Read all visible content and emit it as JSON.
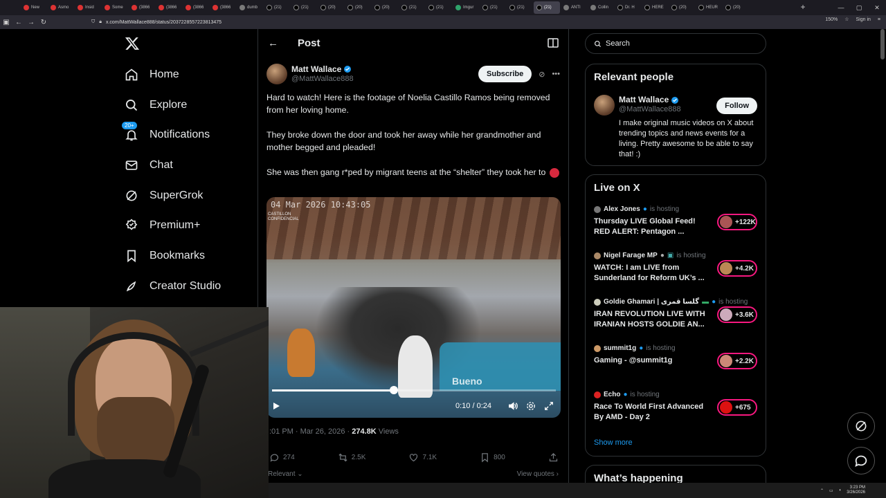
{
  "browser": {
    "tabs": [
      {
        "label": "New",
        "fav": "red"
      },
      {
        "label": "Asmo",
        "fav": "red"
      },
      {
        "label": "Insid",
        "fav": "red"
      },
      {
        "label": "Some",
        "fav": "red"
      },
      {
        "label": "(3866",
        "fav": "red"
      },
      {
        "label": "(3866",
        "fav": "red"
      },
      {
        "label": "(3866",
        "fav": "red"
      },
      {
        "label": "(3866",
        "fav": "red"
      },
      {
        "label": "dumb",
        "fav": "g"
      },
      {
        "label": "(21) ",
        "fav": "x"
      },
      {
        "label": "(21) ",
        "fav": "x"
      },
      {
        "label": "(20) ",
        "fav": "x"
      },
      {
        "label": "(20) ",
        "fav": "x"
      },
      {
        "label": "(20) ",
        "fav": "x"
      },
      {
        "label": "(21) ",
        "fav": "x"
      },
      {
        "label": "(21) ",
        "fav": "x"
      },
      {
        "label": "Imgur",
        "fav": "gr"
      },
      {
        "label": "(21) ",
        "fav": "x"
      },
      {
        "label": "(21) ",
        "fav": "x"
      },
      {
        "label": "(21)",
        "fav": "x",
        "active": true
      },
      {
        "label": "ANTI",
        "fav": "g"
      },
      {
        "label": "Collin",
        "fav": "g"
      },
      {
        "label": "Dr. H",
        "fav": "x"
      },
      {
        "label": "HERE",
        "fav": "x"
      },
      {
        "label": "(20) ",
        "fav": "x"
      },
      {
        "label": "HEUR",
        "fav": "x"
      },
      {
        "label": "(20) ",
        "fav": "x"
      }
    ],
    "url": "x.com/MattWallace888/status/2037228557223813475",
    "zoom": "150%",
    "sign_in": "Sign in"
  },
  "leftnav": {
    "items": [
      {
        "label": "Home",
        "icon": "home-icon"
      },
      {
        "label": "Explore",
        "icon": "search-icon"
      },
      {
        "label": "Notifications",
        "icon": "bell-icon",
        "badge": "20+"
      },
      {
        "label": "Chat",
        "icon": "mail-icon"
      },
      {
        "label": "SuperGrok",
        "icon": "grok-icon"
      },
      {
        "label": "Premium+",
        "icon": "premium-icon"
      },
      {
        "label": "Bookmarks",
        "icon": "bookmark-icon"
      },
      {
        "label": "Creator Studio",
        "icon": "rocket-icon"
      }
    ]
  },
  "main": {
    "header_title": "Post",
    "author": {
      "name": "Matt Wallace",
      "handle": "@MattWallace888",
      "subscribe": "Subscribe"
    },
    "text": {
      "p1": "Hard to watch! Here is the footage of Noelia Castillo Ramos being removed from her loving home.",
      "p2": "They broke down the door and took her away while her grandmother and mother begged and pleaded!",
      "p3": "She was then gang r*ped by migrant teens at the “shelter” they took her to"
    },
    "video": {
      "timestamp": "04 Mar 2026 10:43:05",
      "cam_label_1": "CASTILLON",
      "cam_label_2": "CONFIDENCIAL",
      "caption": "Bueno",
      "time": "0:10 / 0:24",
      "progress": 0.43
    },
    "meta": {
      "time": ":01 PM · Mar 26, 2026 · ",
      "views": "274.8K",
      "views_label": " Views"
    },
    "actions": {
      "replies": "274",
      "reposts": "2.5K",
      "likes": "7.1K",
      "bookmarks": "800"
    },
    "relevant": "Relevant",
    "view_quotes": "View quotes"
  },
  "right": {
    "search_placeholder": "Search",
    "relevant_people": {
      "title": "Relevant people",
      "name": "Matt Wallace",
      "handle": "@MattWallace888",
      "follow": "Follow",
      "bio": "I make original music videos on X about trending topics and news events for a living. Pretty awesome to be able to say that! :)"
    },
    "live": {
      "title": "Live on X",
      "items": [
        {
          "host": "Alex Jones",
          "hosting": "is hosting",
          "title": "Thursday LIVE Global Feed! RED ALERT: Pentagon ...",
          "count": "+122K"
        },
        {
          "host": "Nigel Farage MP",
          "hosting": "is hosting",
          "title": "WATCH: I am LIVE from Sunderland for Reform UK’s ...",
          "count": "+4.2K"
        },
        {
          "host": "Goldie Ghamari | گلسا قمری",
          "hosting": "is hosting",
          "title": "IRAN REVOLUTION LIVE WITH IRANIAN HOSTS GOLDIE AN...",
          "count": "+3.6K"
        },
        {
          "host": "summit1g",
          "hosting": "is hosting",
          "title": "Gaming - @summit1g",
          "count": "+2.2K"
        },
        {
          "host": "Echo",
          "hosting": "is hosting",
          "title": "Race To World First Advanced By AMD - Day 2",
          "count": "+675"
        }
      ],
      "show_more": "Show more"
    },
    "whats_happening": "What’s happening"
  },
  "taskbar": {
    "time": "3:23 PM",
    "date": "3/26/2026"
  },
  "colors": {
    "accent": "#1d9bf0",
    "live_pink": "#f91880",
    "bg": "#000000",
    "border": "#2f3336"
  }
}
